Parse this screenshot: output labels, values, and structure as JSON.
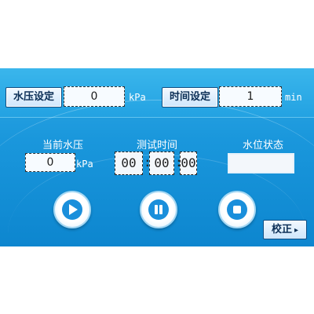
{
  "water_pressure_setting": {
    "label": "水压设定",
    "value": "0",
    "unit": "kPa"
  },
  "time_setting": {
    "label": "时间设定",
    "value": "1",
    "unit": "min"
  },
  "current_pressure": {
    "label": "当前水压",
    "value": "0",
    "unit": "kPa"
  },
  "test_time": {
    "label": "测试时间",
    "hh": "00",
    "mm": "00",
    "ss": "00",
    "sep": ":"
  },
  "water_level": {
    "label": "水位状态",
    "value": ""
  },
  "controls": {
    "play": "play-icon",
    "pause": "pause-icon",
    "stop": "stop-icon"
  },
  "calibrate": {
    "label": "校正",
    "arrow": "▸"
  },
  "colors": {
    "accent": "#1a8fdb",
    "panel": "#1f9edf"
  }
}
